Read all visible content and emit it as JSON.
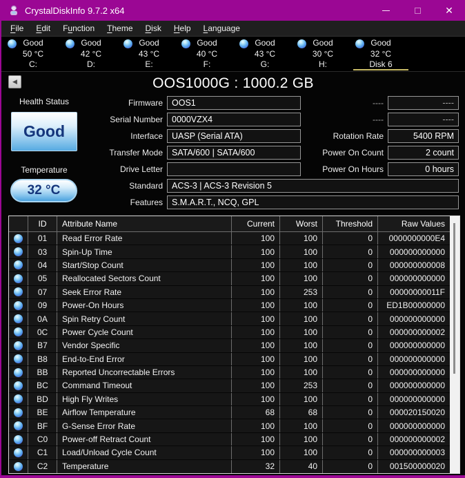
{
  "window": {
    "title": "CrystalDiskInfo 9.7.2 x64",
    "controls": {
      "minimize": "minimize",
      "maximize": "maximize",
      "close": "✕"
    }
  },
  "colors": {
    "titlebar_accent": "#9B0794",
    "tab_underline": "#C8BB66",
    "health_text": "#15367C",
    "health_gradient_top": "#FFFFFF",
    "health_gradient_bottom": "#56AAE2",
    "orb_blue": "#58A8EE"
  },
  "menu": {
    "items": [
      {
        "pre": "",
        "key": "F",
        "post": "ile"
      },
      {
        "pre": "",
        "key": "E",
        "post": "dit"
      },
      {
        "pre": "F",
        "key": "u",
        "post": "nction"
      },
      {
        "pre": "",
        "key": "T",
        "post": "heme"
      },
      {
        "pre": "",
        "key": "D",
        "post": "isk"
      },
      {
        "pre": "",
        "key": "H",
        "post": "elp"
      },
      {
        "pre": "",
        "key": "L",
        "post": "anguage"
      }
    ]
  },
  "tabs": [
    {
      "status": "Good",
      "temp": "50 °C",
      "drive": "C:",
      "selected": false
    },
    {
      "status": "Good",
      "temp": "42 °C",
      "drive": "D:",
      "selected": false
    },
    {
      "status": "Good",
      "temp": "43 °C",
      "drive": "E:",
      "selected": false
    },
    {
      "status": "Good",
      "temp": "40 °C",
      "drive": "F:",
      "selected": false
    },
    {
      "status": "Good",
      "temp": "43 °C",
      "drive": "G:",
      "selected": false
    },
    {
      "status": "Good",
      "temp": "30 °C",
      "drive": "H:",
      "selected": false
    },
    {
      "status": "Good",
      "temp": "32 °C",
      "drive": "Disk 6",
      "selected": true
    }
  ],
  "drive": {
    "back_glyph": "◀",
    "title": "OOS1000G : 1000.2 GB",
    "health": {
      "label": "Health Status",
      "value": "Good"
    },
    "temperature": {
      "label": "Temperature",
      "value": "32 °C"
    },
    "fields_mid": [
      {
        "label": "Firmware",
        "value": "OOS1"
      },
      {
        "label": "Serial Number",
        "value": "0000VZX4"
      },
      {
        "label": "Interface",
        "value": "UASP (Serial ATA)"
      },
      {
        "label": "Transfer Mode",
        "value": "SATA/600 | SATA/600"
      },
      {
        "label": "Drive Letter",
        "value": ""
      }
    ],
    "fields_right": [
      {
        "label": "----",
        "value": "----",
        "dim": true
      },
      {
        "label": "----",
        "value": "----",
        "dim": true
      },
      {
        "label": "Rotation Rate",
        "value": "5400 RPM"
      },
      {
        "label": "Power On Count",
        "value": "2 count"
      },
      {
        "label": "Power On Hours",
        "value": "0 hours"
      }
    ],
    "fields_wide": [
      {
        "label": "Standard",
        "value": "ACS-3 | ACS-3 Revision 5"
      },
      {
        "label": "Features",
        "value": "S.M.A.R.T., NCQ, GPL"
      }
    ]
  },
  "smart_table": {
    "headers": {
      "id": "ID",
      "name": "Attribute Name",
      "current": "Current",
      "worst": "Worst",
      "threshold": "Threshold",
      "raw": "Raw Values"
    },
    "rows": [
      {
        "id": "01",
        "name": "Read Error Rate",
        "current": "100",
        "worst": "100",
        "threshold": "0",
        "raw": "0000000000E4"
      },
      {
        "id": "03",
        "name": "Spin-Up Time",
        "current": "100",
        "worst": "100",
        "threshold": "0",
        "raw": "000000000000"
      },
      {
        "id": "04",
        "name": "Start/Stop Count",
        "current": "100",
        "worst": "100",
        "threshold": "0",
        "raw": "000000000008"
      },
      {
        "id": "05",
        "name": "Reallocated Sectors Count",
        "current": "100",
        "worst": "100",
        "threshold": "0",
        "raw": "000000000000"
      },
      {
        "id": "07",
        "name": "Seek Error Rate",
        "current": "100",
        "worst": "253",
        "threshold": "0",
        "raw": "00000000011F"
      },
      {
        "id": "09",
        "name": "Power-On Hours",
        "current": "100",
        "worst": "100",
        "threshold": "0",
        "raw": "ED1B00000000"
      },
      {
        "id": "0A",
        "name": "Spin Retry Count",
        "current": "100",
        "worst": "100",
        "threshold": "0",
        "raw": "000000000000"
      },
      {
        "id": "0C",
        "name": "Power Cycle Count",
        "current": "100",
        "worst": "100",
        "threshold": "0",
        "raw": "000000000002"
      },
      {
        "id": "B7",
        "name": "Vendor Specific",
        "current": "100",
        "worst": "100",
        "threshold": "0",
        "raw": "000000000000"
      },
      {
        "id": "B8",
        "name": "End-to-End Error",
        "current": "100",
        "worst": "100",
        "threshold": "0",
        "raw": "000000000000"
      },
      {
        "id": "BB",
        "name": "Reported Uncorrectable Errors",
        "current": "100",
        "worst": "100",
        "threshold": "0",
        "raw": "000000000000"
      },
      {
        "id": "BC",
        "name": "Command Timeout",
        "current": "100",
        "worst": "253",
        "threshold": "0",
        "raw": "000000000000"
      },
      {
        "id": "BD",
        "name": "High Fly Writes",
        "current": "100",
        "worst": "100",
        "threshold": "0",
        "raw": "000000000000"
      },
      {
        "id": "BE",
        "name": "Airflow Temperature",
        "current": "68",
        "worst": "68",
        "threshold": "0",
        "raw": "000020150020"
      },
      {
        "id": "BF",
        "name": "G-Sense Error Rate",
        "current": "100",
        "worst": "100",
        "threshold": "0",
        "raw": "000000000000"
      },
      {
        "id": "C0",
        "name": "Power-off Retract Count",
        "current": "100",
        "worst": "100",
        "threshold": "0",
        "raw": "000000000002"
      },
      {
        "id": "C1",
        "name": "Load/Unload Cycle Count",
        "current": "100",
        "worst": "100",
        "threshold": "0",
        "raw": "000000000003"
      },
      {
        "id": "C2",
        "name": "Temperature",
        "current": "32",
        "worst": "40",
        "threshold": "0",
        "raw": "001500000020"
      }
    ]
  }
}
